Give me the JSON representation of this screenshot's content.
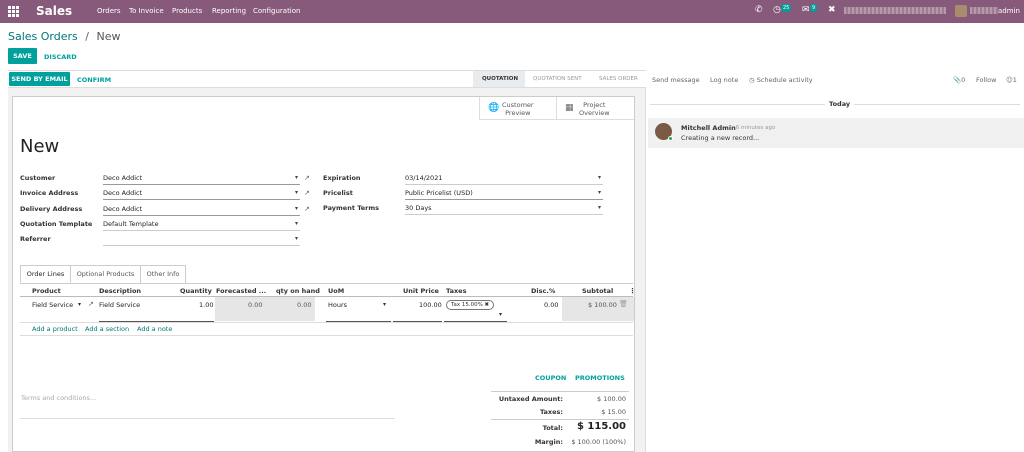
{
  "topbar": {
    "app_name": "Sales",
    "menu": [
      "Orders",
      "To Invoice",
      "Products",
      "Reporting",
      "Configuration"
    ],
    "activity_badge": "25",
    "messages_badge": "9",
    "user_suffix": "admin"
  },
  "breadcrumb": {
    "parent": "Sales Orders",
    "separator": "/",
    "current": "New"
  },
  "actions": {
    "save": "SAVE",
    "discard": "DISCARD",
    "send_by_email": "SEND BY EMAIL",
    "confirm": "CONFIRM"
  },
  "stages": [
    "QUOTATION",
    "QUOTATION SENT",
    "SALES ORDER"
  ],
  "smart_buttons": {
    "customer_preview_1": "Customer",
    "customer_preview_2": "Preview",
    "project_overview_1": "Project",
    "project_overview_2": "Overview"
  },
  "record_title": "New",
  "fields_left": [
    {
      "label": "Customer",
      "value": "Deco Addict"
    },
    {
      "label": "Invoice Address",
      "value": "Deco Addict"
    },
    {
      "label": "Delivery Address",
      "value": "Deco Addict"
    },
    {
      "label": "Quotation Template",
      "value": "Default Template"
    },
    {
      "label": "Referrer",
      "value": ""
    }
  ],
  "fields_right": [
    {
      "label": "Expiration",
      "value": "03/14/2021"
    },
    {
      "label": "Pricelist",
      "value": "Public Pricelist (USD)"
    },
    {
      "label": "Payment Terms",
      "value": "30 Days"
    }
  ],
  "tabs": [
    "Order Lines",
    "Optional Products",
    "Other Info"
  ],
  "columns": [
    "Product",
    "Description",
    "Quantity",
    "Forecasted ...",
    "qty on hand",
    "UoM",
    "Unit Price",
    "Taxes",
    "Disc.%",
    "Subtotal"
  ],
  "line": {
    "product": "Field Service",
    "description": "Field Service",
    "quantity": "1.00",
    "forecasted": "0.00",
    "qty_on_hand": "0.00",
    "uom": "Hours",
    "unit_price": "100.00",
    "tax": "Tax 15.00%",
    "discount": "0.00",
    "subtotal": "$ 100.00"
  },
  "add_links": [
    "Add a product",
    "Add a section",
    "Add a note"
  ],
  "promo": {
    "coupon": "COUPON",
    "promotions": "PROMOTIONS"
  },
  "terms_placeholder": "Terms and conditions...",
  "totals": [
    {
      "label": "Untaxed Amount:",
      "value": "$ 100.00"
    },
    {
      "label": "Taxes:",
      "value": "$ 15.00"
    },
    {
      "label": "Total:",
      "value": "$ 115.00"
    },
    {
      "label": "Margin:",
      "value": "$ 100.00 (100%)"
    }
  ],
  "chatter": {
    "send_message": "Send message",
    "log_note": "Log note",
    "schedule_activity": "Schedule activity",
    "attachments": "0",
    "follow": "Follow",
    "followers": "1",
    "today": "Today",
    "author": "Mitchell Admin",
    "time": "- 6 minutes ago",
    "body": "Creating a new record..."
  },
  "colors": {
    "brand": "#875a7b",
    "accent": "#00a09d"
  }
}
